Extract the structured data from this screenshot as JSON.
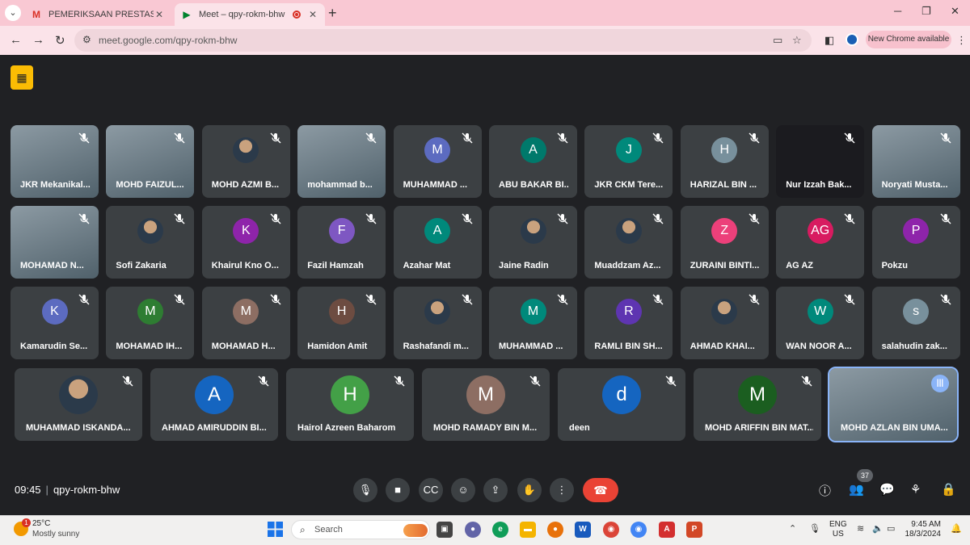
{
  "browser": {
    "tabs": [
      {
        "title": "PEMERIKSAAN PRESTASI MOBI",
        "favicon": "gmail-icon",
        "active": false
      },
      {
        "title": "Meet – qpy-rokm-bhw",
        "favicon": "meet-icon",
        "active": true
      }
    ],
    "url": "meet.google.com/qpy-rokm-bhw",
    "new_chrome_label": "New Chrome available"
  },
  "participants": [
    {
      "name": "JKR Mekanikal...",
      "avatar": "",
      "video": true
    },
    {
      "name": "MOHD FAIZUL...",
      "avatar": "",
      "video": true
    },
    {
      "name": "MOHD AZMI B...",
      "avatar": "",
      "photo": true
    },
    {
      "name": "mohammad b...",
      "avatar": "",
      "video": true
    },
    {
      "name": "MUHAMMAD ...",
      "avatar": "M",
      "color": "#5c6bc0"
    },
    {
      "name": "ABU BAKAR BI...",
      "avatar": "A",
      "color": "#00796b"
    },
    {
      "name": "JKR CKM Tere...",
      "avatar": "J",
      "color": "#00897b"
    },
    {
      "name": "HARIZAL BIN ...",
      "avatar": "H",
      "color": "#78909c"
    },
    {
      "name": "Nur Izzah Bak...",
      "avatar": "",
      "video": true,
      "dark": true
    },
    {
      "name": "Noryati Musta...",
      "avatar": "",
      "video": true
    },
    {
      "name": "MOHAMAD N...",
      "avatar": "",
      "video": true
    },
    {
      "name": "Sofi Zakaria",
      "avatar": "",
      "photo": true
    },
    {
      "name": "Khairul Kno O...",
      "avatar": "K",
      "color": "#8e24aa"
    },
    {
      "name": "Fazil Hamzah",
      "avatar": "F",
      "color": "#7e57c2"
    },
    {
      "name": "Azahar Mat",
      "avatar": "A",
      "color": "#00897b"
    },
    {
      "name": "Jaine Radin",
      "avatar": "",
      "photo": true
    },
    {
      "name": "Muaddzam Az...",
      "avatar": "",
      "photo": true
    },
    {
      "name": "ZURAINI BINTI...",
      "avatar": "Z",
      "color": "#ec407a"
    },
    {
      "name": "AG AZ",
      "avatar": "AG",
      "color": "#d81b60"
    },
    {
      "name": "Pokzu",
      "avatar": "P",
      "color": "#8e24aa"
    },
    {
      "name": "Kamarudin Se...",
      "avatar": "K",
      "color": "#5c6bc0"
    },
    {
      "name": "MOHAMAD IH...",
      "avatar": "M",
      "color": "#2e7d32"
    },
    {
      "name": "MOHAMAD H...",
      "avatar": "M",
      "color": "#8d6e63"
    },
    {
      "name": "Hamidon Amit",
      "avatar": "H",
      "color": "#6d4c41"
    },
    {
      "name": "Rashafandi m...",
      "avatar": "",
      "photo": true
    },
    {
      "name": "MUHAMMAD ...",
      "avatar": "M",
      "color": "#00897b"
    },
    {
      "name": "RAMLI BIN SH...",
      "avatar": "R",
      "color": "#5e35b1"
    },
    {
      "name": "AHMAD KHAI...",
      "avatar": "",
      "photo": true
    },
    {
      "name": "WAN NOOR A...",
      "avatar": "W",
      "color": "#00897b"
    },
    {
      "name": "salahudin zak...",
      "avatar": "s",
      "color": "#78909c"
    },
    {
      "name": "MUHAMMAD ISKANDA...",
      "avatar": "",
      "photo": true
    },
    {
      "name": "AHMAD AMIRUDDIN BI...",
      "avatar": "A",
      "color": "#1565c0"
    },
    {
      "name": "Hairol Azreen Baharom",
      "avatar": "H",
      "color": "#43a047"
    },
    {
      "name": "MOHD RAMADY BIN M...",
      "avatar": "M",
      "color": "#8d6e63"
    },
    {
      "name": "deen",
      "avatar": "d",
      "color": "#1565c0"
    },
    {
      "name": "MOHD ARIFFIN BIN MAT...",
      "avatar": "M",
      "color": "#1b5e20"
    },
    {
      "name": "MOHD AZLAN BIN UMA...",
      "avatar": "",
      "video": true,
      "speaking": true
    }
  ],
  "meet": {
    "time": "09:45",
    "code": "qpy-rokm-bhw",
    "participant_count": "37"
  },
  "taskbar": {
    "weather_temp": "25°C",
    "weather_desc": "Mostly sunny",
    "weather_badge": "1",
    "search_label": "Search",
    "lang_top": "ENG",
    "lang_bottom": "US",
    "time": "9:45 AM",
    "date": "18/3/2024"
  }
}
